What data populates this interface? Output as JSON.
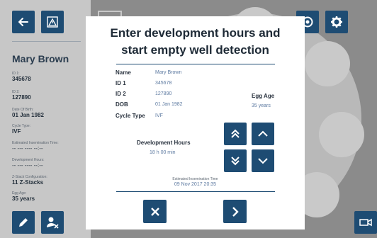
{
  "sidebar": {
    "patient_name": "Mary Brown",
    "fields": [
      {
        "label": "ID 1:",
        "value": "345678"
      },
      {
        "label": "ID 2:",
        "value": "127890"
      },
      {
        "label": "Date Of Birth:",
        "value": "01 Jan 1982"
      },
      {
        "label": "Cycle Type:",
        "value": "IVF"
      },
      {
        "label": "Estimated Insemination Time:",
        "value": "-- --- ---- --:--"
      },
      {
        "label": "Development Hours:",
        "value": "-- --- ---- --:--"
      },
      {
        "label": "Z-Stack Configuration:",
        "value": "11 Z-Stacks"
      },
      {
        "label": "Egg Age:",
        "value": "35 years"
      }
    ]
  },
  "modal": {
    "title_line1": "Enter development hours and",
    "title_line2": "start empty well detection",
    "info": [
      {
        "label": "Name",
        "value": "Mary Brown"
      },
      {
        "label": "ID 1",
        "value": "345678"
      },
      {
        "label": "ID 2",
        "value": "127890"
      },
      {
        "label": "DOB",
        "value": "01 Jan 1982"
      },
      {
        "label": "Cycle Type",
        "value": "IVF"
      }
    ],
    "egg_age_label": "Egg Age",
    "egg_age_value": "35 years",
    "dev_hours_label": "Development Hours",
    "dev_hours_value": "18 h 00 min",
    "insemination_label": "Estimated Insemination Time",
    "insemination_value": "09 Nov 2017 20:35"
  },
  "colors": {
    "accent": "#1e4c73",
    "value_text": "#5c79a0"
  }
}
